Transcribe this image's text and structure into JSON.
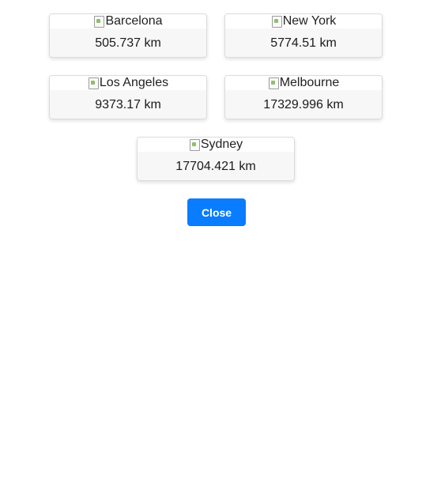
{
  "cities": [
    {
      "name": "Barcelona",
      "distance": "505.737 km"
    },
    {
      "name": "New York",
      "distance": "5774.51 km"
    },
    {
      "name": "Los Angeles",
      "distance": "9373.17 km"
    },
    {
      "name": "Melbourne",
      "distance": "17329.996 km"
    },
    {
      "name": "Sydney",
      "distance": "17704.421 km"
    }
  ],
  "close_label": "Close",
  "colors": {
    "button": "#0a7cff",
    "card_bg": "#f7f7f7"
  }
}
